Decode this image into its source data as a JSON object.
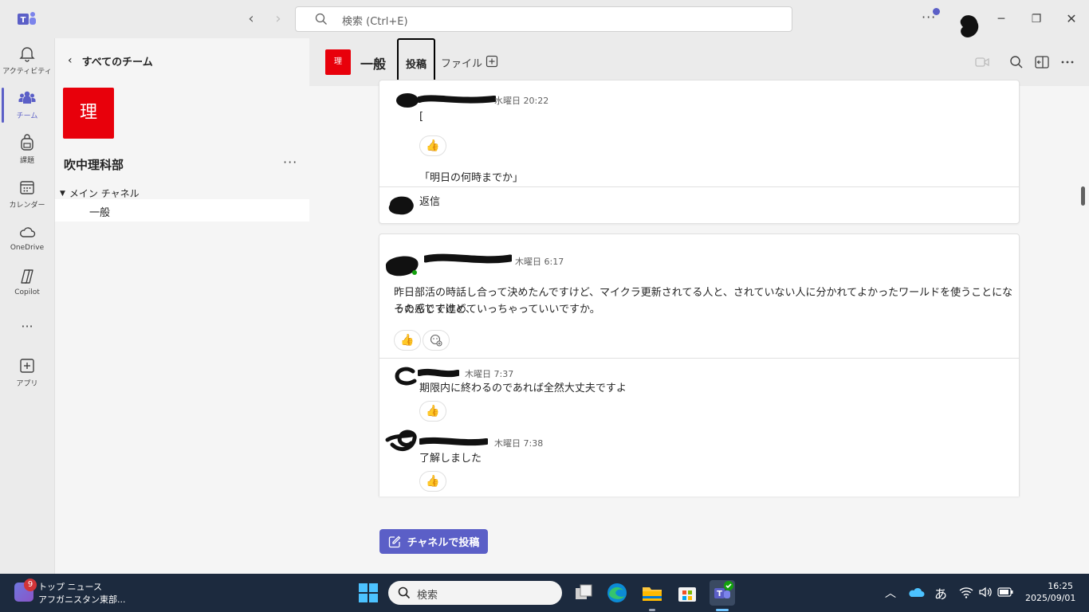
{
  "titlebar": {
    "search_placeholder": "検索 (Ctrl+E)",
    "more_label": "···"
  },
  "rail": {
    "items": [
      {
        "label": "アクティビティ",
        "icon": "bell-icon"
      },
      {
        "label": "チーム",
        "icon": "teams-icon"
      },
      {
        "label": "課題",
        "icon": "backpack-icon"
      },
      {
        "label": "カレンダー",
        "icon": "calendar-icon"
      },
      {
        "label": "OneDrive",
        "icon": "cloud-icon"
      },
      {
        "label": "Copilot",
        "icon": "copilot-icon"
      },
      {
        "label": "···",
        "icon": "more-icon"
      },
      {
        "label": "アプリ",
        "icon": "add-app-icon"
      }
    ]
  },
  "sidebar": {
    "back_label": "すべてのチーム",
    "team_initial": "理",
    "team_name": "吹中理科部",
    "more_label": "···",
    "channel_group": "メイン チャネル",
    "channel": "一般"
  },
  "header": {
    "team_initial": "理",
    "channel_name": "一般",
    "tabs": [
      {
        "label": "投稿",
        "active": true
      },
      {
        "label": "ファイル",
        "active": false
      }
    ]
  },
  "messages": {
    "thread1": {
      "meta": "水曜日 20:22",
      "line1": "[",
      "line2": "「明日の何時までか」",
      "reaction": "👍",
      "reply_label": "返信"
    },
    "thread2": {
      "post_meta": "木曜日 6:17",
      "post_text_1": "昨日部活の時話し合って決めたんですけど、マイクラ更新されてる人と、されていない人に分かれてよかったワールドを使うことになったんですけど、",
      "post_text_2": "その感じで進めていっちゃっていいですか。",
      "reaction": "👍",
      "reply1_meta": "木曜日 7:37",
      "reply1_text": "期限内に終わるのであれば全然大丈夫ですよ",
      "reply2_meta": "木曜日 7:38",
      "reply2_text": "了解しました"
    }
  },
  "compose": {
    "button_label": "チャネルで投稿"
  },
  "taskbar": {
    "news_badge": "9",
    "news_title": "トップ ニュース",
    "news_sub": "アフガニスタン東部...",
    "search_label": "検索",
    "ime": "あ",
    "time": "16:25",
    "date": "2025/09/01"
  },
  "colors": {
    "accent": "#5b5fc7",
    "team_tile": "#e8000b",
    "taskbar": "#1c2a3e"
  }
}
